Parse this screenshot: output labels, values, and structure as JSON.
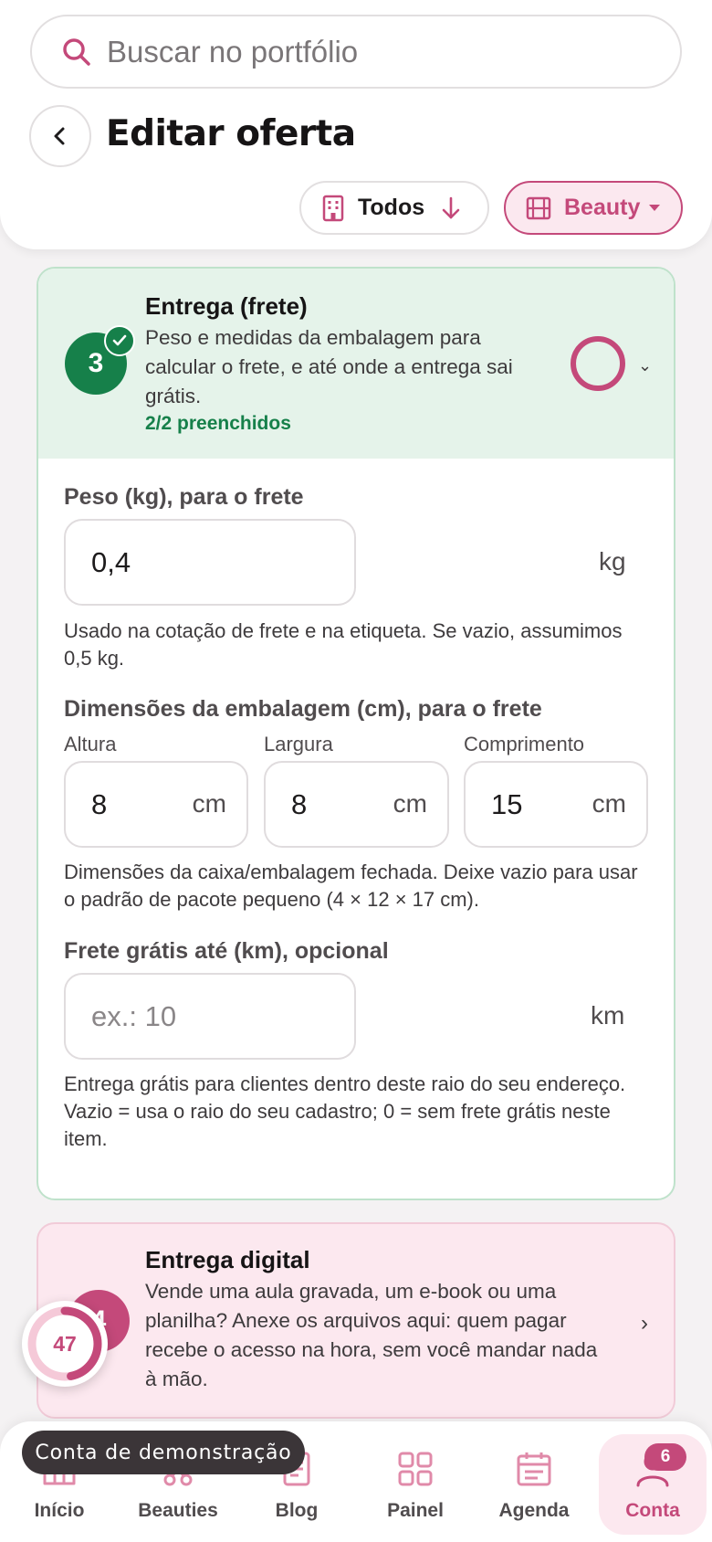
{
  "search": {
    "placeholder": "Buscar no portfólio"
  },
  "header": {
    "title": "Editar oferta"
  },
  "filters": {
    "scope_label": "Todos",
    "category_label": "Beauty"
  },
  "shipping_section": {
    "step_number": "3",
    "title": "Entrega (frete)",
    "description": "Peso e medidas da embalagem para calcular o frete, e até onde a entrega sai grátis.",
    "status": "2/2 preenchidos",
    "weight": {
      "label": "Peso (kg), para o frete",
      "value": "0,4",
      "unit": "kg",
      "help": "Usado na cotação de frete e na etiqueta. Se vazio, assumimos 0,5 kg."
    },
    "dimensions": {
      "label": "Dimensões da embalagem (cm), para o frete",
      "height_label": "Altura",
      "height_value": "8",
      "width_label": "Largura",
      "width_value": "8",
      "length_label": "Comprimento",
      "length_value": "15",
      "unit": "cm",
      "help": "Dimensões da caixa/embalagem fechada. Deixe vazio para usar o padrão de pacote pequeno (4 × 12 × 17 cm)."
    },
    "free_shipping": {
      "label": "Frete grátis até (km), opcional",
      "value": "",
      "placeholder": "ex.: 10",
      "unit": "km",
      "help": "Entrega grátis para clientes dentro deste raio do seu endereço. Vazio = usa o raio do seu cadastro; 0 = sem frete grátis neste item."
    }
  },
  "digital_section": {
    "step_number": "4",
    "title": "Entrega digital",
    "description": "Vende uma aula gravada, um e-book ou uma planilha? Anexe os arquivos aqui: quem pagar recebe o acesso na hora, sem você mandar nada à mão."
  },
  "score": {
    "value": "47",
    "progress": 0.47
  },
  "demo_banner": "Conta de demonstração",
  "bottom_nav": {
    "home": "Início",
    "beauties": "Beauties",
    "blog": "Blog",
    "panel": "Painel",
    "agenda": "Agenda",
    "account": "Conta",
    "account_badge": "6"
  },
  "colors": {
    "accent": "#c4497a",
    "accent_bg": "#fce8ef",
    "success": "#16804a",
    "success_bg": "#e5f3ea"
  }
}
